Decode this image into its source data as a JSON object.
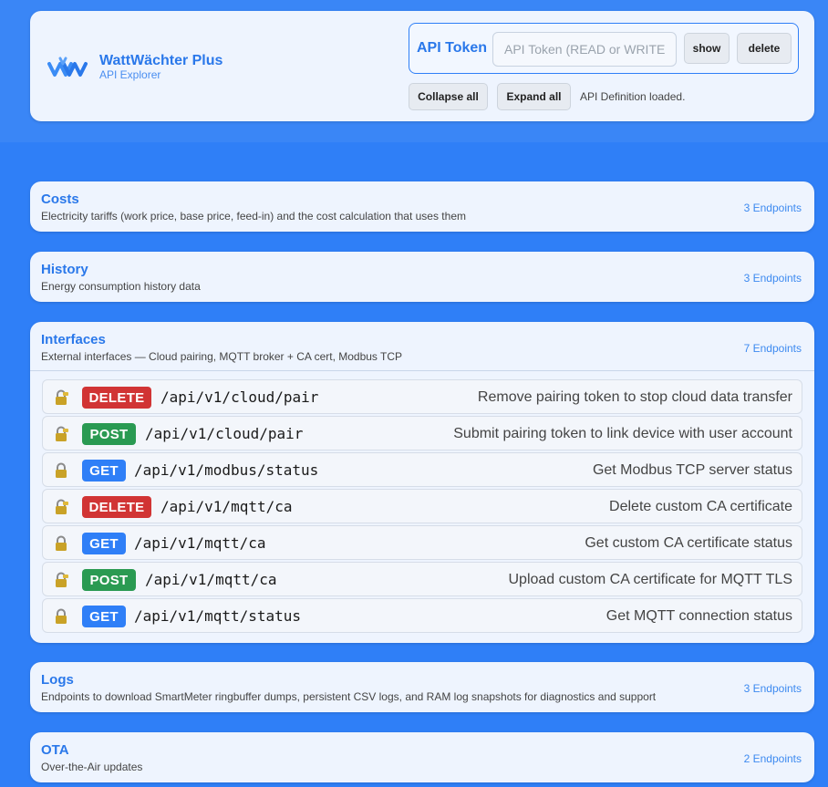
{
  "app": {
    "name": "WattWächter Plus",
    "subtitle": "API Explorer"
  },
  "token": {
    "label": "API Token",
    "placeholder": "API Token (READ or WRITE)",
    "value": "",
    "show_label": "show",
    "delete_label": "delete"
  },
  "toolbar": {
    "collapse_label": "Collapse all",
    "expand_label": "Expand all",
    "status": "API Definition loaded."
  },
  "colors": {
    "accent": "#2f7ff7",
    "delete": "#d13434",
    "post": "#2a9a52",
    "get": "#2f7ff7"
  },
  "sections": {
    "costs": {
      "title": "Costs",
      "desc": "Electricity tariffs (work price, base price, feed-in) and the cost calculation that uses them",
      "count": "3 Endpoints"
    },
    "history": {
      "title": "History",
      "desc": "Energy consumption history data",
      "count": "3 Endpoints"
    },
    "interfaces": {
      "title": "Interfaces",
      "desc": "External interfaces — Cloud pairing, MQTT broker + CA cert, Modbus TCP",
      "count": "7 Endpoints",
      "endpoints": [
        {
          "method": "DELETE",
          "path": "/api/v1/cloud/pair",
          "summary": "Remove pairing token to stop cloud data transfer",
          "lock": "lock-write-icon"
        },
        {
          "method": "POST",
          "path": "/api/v1/cloud/pair",
          "summary": "Submit pairing token to link device with user account",
          "lock": "lock-write-icon"
        },
        {
          "method": "GET",
          "path": "/api/v1/modbus/status",
          "summary": "Get Modbus TCP server status",
          "lock": "lock-icon"
        },
        {
          "method": "DELETE",
          "path": "/api/v1/mqtt/ca",
          "summary": "Delete custom CA certificate",
          "lock": "lock-write-icon"
        },
        {
          "method": "GET",
          "path": "/api/v1/mqtt/ca",
          "summary": "Get custom CA certificate status",
          "lock": "lock-icon"
        },
        {
          "method": "POST",
          "path": "/api/v1/mqtt/ca",
          "summary": "Upload custom CA certificate for MQTT TLS",
          "lock": "lock-write-icon"
        },
        {
          "method": "GET",
          "path": "/api/v1/mqtt/status",
          "summary": "Get MQTT connection status",
          "lock": "lock-icon"
        }
      ]
    },
    "logs": {
      "title": "Logs",
      "desc": "Endpoints to download SmartMeter ringbuffer dumps, persistent CSV logs, and RAM log snapshots for diagnostics and support",
      "count": "3 Endpoints"
    },
    "ota": {
      "title": "OTA",
      "desc": "Over-the-Air updates",
      "count": "2 Endpoints"
    }
  }
}
